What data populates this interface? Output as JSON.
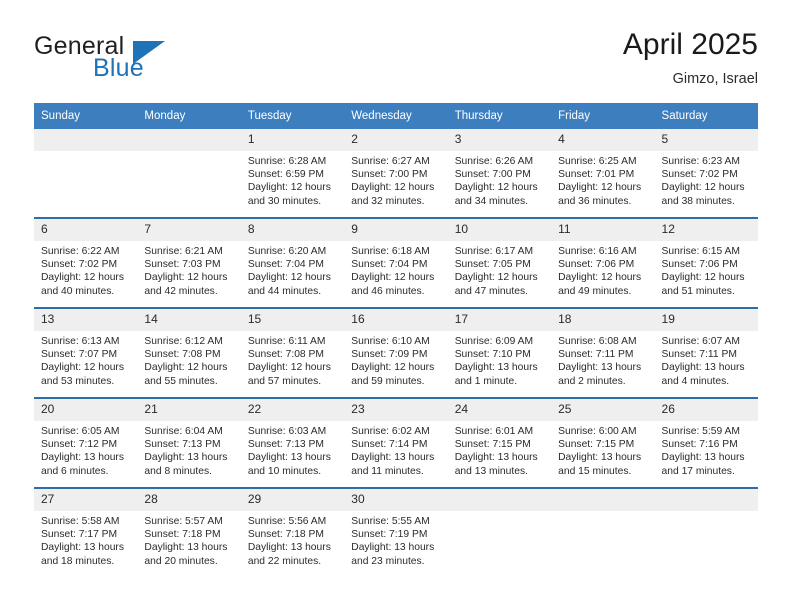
{
  "brand": {
    "line1": "General",
    "line2": "Blue",
    "triangle_color": "#1e72b8"
  },
  "header": {
    "title": "April 2025",
    "location": "Gimzo, Israel"
  },
  "theme": {
    "header_blue": "#3d7ebf",
    "row_border_blue": "#2e6da8",
    "daynum_band": "#efefef"
  },
  "calendar": {
    "weekday_headers": [
      "Sunday",
      "Monday",
      "Tuesday",
      "Wednesday",
      "Thursday",
      "Friday",
      "Saturday"
    ],
    "weeks": [
      [
        {
          "day": "",
          "sunrise": "",
          "sunset": "",
          "daylight": "",
          "empty": true
        },
        {
          "day": "",
          "sunrise": "",
          "sunset": "",
          "daylight": "",
          "empty": true
        },
        {
          "day": "1",
          "sunrise": "Sunrise: 6:28 AM",
          "sunset": "Sunset: 6:59 PM",
          "daylight": "Daylight: 12 hours and 30 minutes."
        },
        {
          "day": "2",
          "sunrise": "Sunrise: 6:27 AM",
          "sunset": "Sunset: 7:00 PM",
          "daylight": "Daylight: 12 hours and 32 minutes."
        },
        {
          "day": "3",
          "sunrise": "Sunrise: 6:26 AM",
          "sunset": "Sunset: 7:00 PM",
          "daylight": "Daylight: 12 hours and 34 minutes."
        },
        {
          "day": "4",
          "sunrise": "Sunrise: 6:25 AM",
          "sunset": "Sunset: 7:01 PM",
          "daylight": "Daylight: 12 hours and 36 minutes."
        },
        {
          "day": "5",
          "sunrise": "Sunrise: 6:23 AM",
          "sunset": "Sunset: 7:02 PM",
          "daylight": "Daylight: 12 hours and 38 minutes."
        }
      ],
      [
        {
          "day": "6",
          "sunrise": "Sunrise: 6:22 AM",
          "sunset": "Sunset: 7:02 PM",
          "daylight": "Daylight: 12 hours and 40 minutes."
        },
        {
          "day": "7",
          "sunrise": "Sunrise: 6:21 AM",
          "sunset": "Sunset: 7:03 PM",
          "daylight": "Daylight: 12 hours and 42 minutes."
        },
        {
          "day": "8",
          "sunrise": "Sunrise: 6:20 AM",
          "sunset": "Sunset: 7:04 PM",
          "daylight": "Daylight: 12 hours and 44 minutes."
        },
        {
          "day": "9",
          "sunrise": "Sunrise: 6:18 AM",
          "sunset": "Sunset: 7:04 PM",
          "daylight": "Daylight: 12 hours and 46 minutes."
        },
        {
          "day": "10",
          "sunrise": "Sunrise: 6:17 AM",
          "sunset": "Sunset: 7:05 PM",
          "daylight": "Daylight: 12 hours and 47 minutes."
        },
        {
          "day": "11",
          "sunrise": "Sunrise: 6:16 AM",
          "sunset": "Sunset: 7:06 PM",
          "daylight": "Daylight: 12 hours and 49 minutes."
        },
        {
          "day": "12",
          "sunrise": "Sunrise: 6:15 AM",
          "sunset": "Sunset: 7:06 PM",
          "daylight": "Daylight: 12 hours and 51 minutes."
        }
      ],
      [
        {
          "day": "13",
          "sunrise": "Sunrise: 6:13 AM",
          "sunset": "Sunset: 7:07 PM",
          "daylight": "Daylight: 12 hours and 53 minutes."
        },
        {
          "day": "14",
          "sunrise": "Sunrise: 6:12 AM",
          "sunset": "Sunset: 7:08 PM",
          "daylight": "Daylight: 12 hours and 55 minutes."
        },
        {
          "day": "15",
          "sunrise": "Sunrise: 6:11 AM",
          "sunset": "Sunset: 7:08 PM",
          "daylight": "Daylight: 12 hours and 57 minutes."
        },
        {
          "day": "16",
          "sunrise": "Sunrise: 6:10 AM",
          "sunset": "Sunset: 7:09 PM",
          "daylight": "Daylight: 12 hours and 59 minutes."
        },
        {
          "day": "17",
          "sunrise": "Sunrise: 6:09 AM",
          "sunset": "Sunset: 7:10 PM",
          "daylight": "Daylight: 13 hours and 1 minute."
        },
        {
          "day": "18",
          "sunrise": "Sunrise: 6:08 AM",
          "sunset": "Sunset: 7:11 PM",
          "daylight": "Daylight: 13 hours and 2 minutes."
        },
        {
          "day": "19",
          "sunrise": "Sunrise: 6:07 AM",
          "sunset": "Sunset: 7:11 PM",
          "daylight": "Daylight: 13 hours and 4 minutes."
        }
      ],
      [
        {
          "day": "20",
          "sunrise": "Sunrise: 6:05 AM",
          "sunset": "Sunset: 7:12 PM",
          "daylight": "Daylight: 13 hours and 6 minutes."
        },
        {
          "day": "21",
          "sunrise": "Sunrise: 6:04 AM",
          "sunset": "Sunset: 7:13 PM",
          "daylight": "Daylight: 13 hours and 8 minutes."
        },
        {
          "day": "22",
          "sunrise": "Sunrise: 6:03 AM",
          "sunset": "Sunset: 7:13 PM",
          "daylight": "Daylight: 13 hours and 10 minutes."
        },
        {
          "day": "23",
          "sunrise": "Sunrise: 6:02 AM",
          "sunset": "Sunset: 7:14 PM",
          "daylight": "Daylight: 13 hours and 11 minutes."
        },
        {
          "day": "24",
          "sunrise": "Sunrise: 6:01 AM",
          "sunset": "Sunset: 7:15 PM",
          "daylight": "Daylight: 13 hours and 13 minutes."
        },
        {
          "day": "25",
          "sunrise": "Sunrise: 6:00 AM",
          "sunset": "Sunset: 7:15 PM",
          "daylight": "Daylight: 13 hours and 15 minutes."
        },
        {
          "day": "26",
          "sunrise": "Sunrise: 5:59 AM",
          "sunset": "Sunset: 7:16 PM",
          "daylight": "Daylight: 13 hours and 17 minutes."
        }
      ],
      [
        {
          "day": "27",
          "sunrise": "Sunrise: 5:58 AM",
          "sunset": "Sunset: 7:17 PM",
          "daylight": "Daylight: 13 hours and 18 minutes."
        },
        {
          "day": "28",
          "sunrise": "Sunrise: 5:57 AM",
          "sunset": "Sunset: 7:18 PM",
          "daylight": "Daylight: 13 hours and 20 minutes."
        },
        {
          "day": "29",
          "sunrise": "Sunrise: 5:56 AM",
          "sunset": "Sunset: 7:18 PM",
          "daylight": "Daylight: 13 hours and 22 minutes."
        },
        {
          "day": "30",
          "sunrise": "Sunrise: 5:55 AM",
          "sunset": "Sunset: 7:19 PM",
          "daylight": "Daylight: 13 hours and 23 minutes."
        },
        {
          "day": "",
          "sunrise": "",
          "sunset": "",
          "daylight": "",
          "empty": true
        },
        {
          "day": "",
          "sunrise": "",
          "sunset": "",
          "daylight": "",
          "empty": true
        },
        {
          "day": "",
          "sunrise": "",
          "sunset": "",
          "daylight": "",
          "empty": true
        }
      ]
    ]
  }
}
